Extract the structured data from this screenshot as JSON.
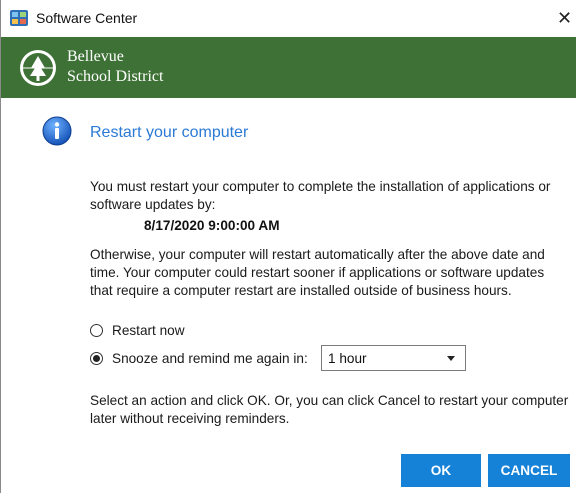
{
  "window": {
    "title": "Software Center",
    "close_glyph": "✕"
  },
  "banner": {
    "line1": "Bellevue",
    "line2": "School District",
    "logo_icon": "tree-seal-icon",
    "background": "#3e7135"
  },
  "dialog": {
    "heading": "Restart your computer",
    "heading_color": "#2a7ad6",
    "info_icon": "info-icon",
    "message1": "You must restart your computer to complete the installation of applications or software updates by:",
    "deadline": "8/17/2020 9:00:00 AM",
    "message2": "Otherwise, your computer will restart automatically after the above date and time.  Your computer could restart sooner if applications or software updates that require a computer restart are installed outside of business hours.",
    "options": [
      {
        "label": "Restart now",
        "selected": false
      },
      {
        "label": "Snooze and remind me again in:",
        "selected": true
      }
    ],
    "snooze_value": "1 hour",
    "message3": "Select an action and click OK.  Or, you can click Cancel to restart your computer later without receiving reminders."
  },
  "buttons": {
    "ok_label": "OK",
    "cancel_label": "CANCEL",
    "color": "#1582d8"
  }
}
